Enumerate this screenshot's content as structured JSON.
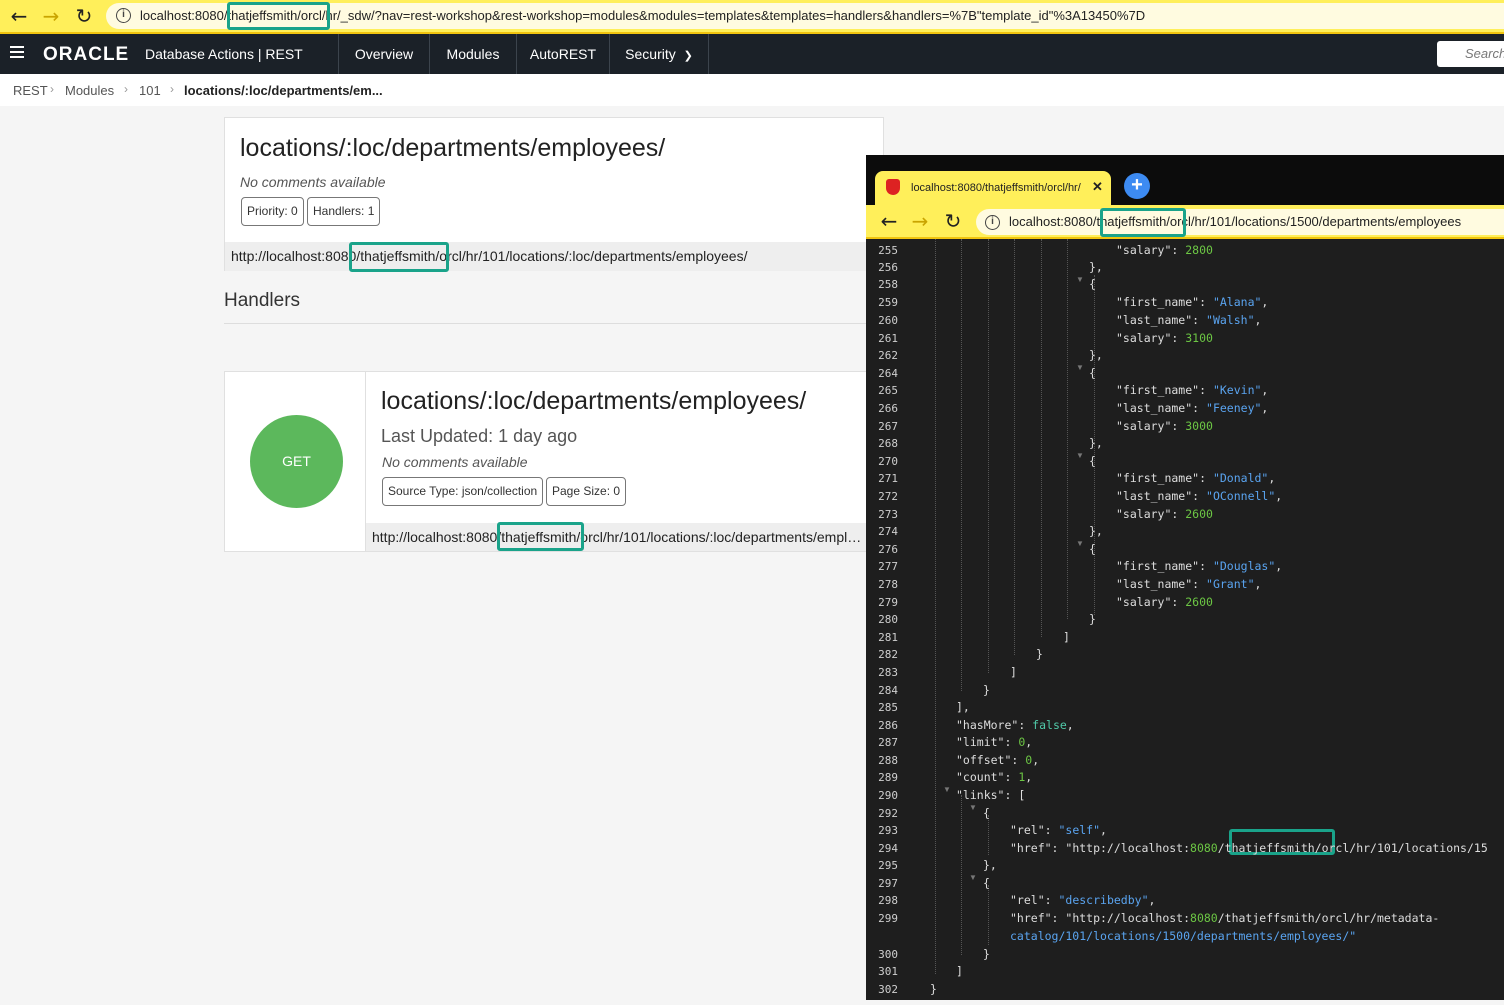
{
  "browser": {
    "url": "localhost:8080/thatjeffsmith/orcl/hr/_sdw/?nav=rest-workshop&rest-workshop=modules&modules=templates&templates=handlers&handlers=%7B\"template_id\"%3A13450%7D"
  },
  "app": {
    "logo": "ORACLE",
    "title": "Database Actions |  REST",
    "nav": [
      "Overview",
      "Modules",
      "AutoREST",
      "Security"
    ],
    "search_placeholder": "Search"
  },
  "breadcrumb": [
    "REST",
    "Modules",
    "101",
    "locations/:loc/departments/em..."
  ],
  "template_card": {
    "title": "locations/:loc/departments/employees/",
    "comment": "No comments available",
    "chips": [
      "Priority: 0",
      "Handlers: 1"
    ],
    "url": "http://localhost:8080/thatjeffsmith/orcl/hr/101/locations/:loc/departments/employees/"
  },
  "handlers_heading": "Handlers",
  "handler_card": {
    "method": "GET",
    "title": "locations/:loc/departments/employees/",
    "last_updated": "Last Updated: 1 day ago",
    "comment": "No comments available",
    "chips": [
      "Source Type: json/collection",
      "Page Size: 0"
    ],
    "url": "http://localhost:8080/thatjeffsmith/orcl/hr/101/locations/:loc/departments/empl…"
  },
  "second_window": {
    "tab_title": "localhost:8080/thatjeffsmith/orcl/hr/",
    "url": "localhost:8080/thatjeffsmith/orcl/hr/101/locations/1500/departments/employees",
    "json_lines": [
      {
        "n": "255",
        "text": "\"salary\": 2800"
      },
      {
        "n": "256",
        "text": "},"
      },
      {
        "n": "258",
        "text": "{"
      },
      {
        "n": "259",
        "text": "\"first_name\": \"Alana\","
      },
      {
        "n": "260",
        "text": "\"last_name\": \"Walsh\","
      },
      {
        "n": "261",
        "text": "\"salary\": 3100"
      },
      {
        "n": "262",
        "text": "},"
      },
      {
        "n": "264",
        "text": "{"
      },
      {
        "n": "265",
        "text": "\"first_name\": \"Kevin\","
      },
      {
        "n": "266",
        "text": "\"last_name\": \"Feeney\","
      },
      {
        "n": "267",
        "text": "\"salary\": 3000"
      },
      {
        "n": "268",
        "text": "},"
      },
      {
        "n": "270",
        "text": "{"
      },
      {
        "n": "271",
        "text": "\"first_name\": \"Donald\","
      },
      {
        "n": "272",
        "text": "\"last_name\": \"OConnell\","
      },
      {
        "n": "273",
        "text": "\"salary\": 2600"
      },
      {
        "n": "274",
        "text": "},"
      },
      {
        "n": "276",
        "text": "{"
      },
      {
        "n": "277",
        "text": "\"first_name\": \"Douglas\","
      },
      {
        "n": "278",
        "text": "\"last_name\": \"Grant\","
      },
      {
        "n": "279",
        "text": "\"salary\": 2600"
      },
      {
        "n": "280",
        "text": "}"
      },
      {
        "n": "281",
        "text": "]"
      },
      {
        "n": "282",
        "text": "}"
      },
      {
        "n": "283",
        "text": "]"
      },
      {
        "n": "284",
        "text": "}"
      },
      {
        "n": "285",
        "text": "],"
      },
      {
        "n": "286",
        "text": "\"hasMore\": false,"
      },
      {
        "n": "287",
        "text": "\"limit\": 0,"
      },
      {
        "n": "288",
        "text": "\"offset\": 0,"
      },
      {
        "n": "289",
        "text": "\"count\": 1,"
      },
      {
        "n": "290",
        "text": "\"links\": ["
      },
      {
        "n": "292",
        "text": "{"
      },
      {
        "n": "293",
        "text": "\"rel\": \"self\","
      },
      {
        "n": "294",
        "text": "\"href\": \"http://localhost:8080/thatjeffsmith/orcl/hr/101/locations/15"
      },
      {
        "n": "295",
        "text": "},"
      },
      {
        "n": "297",
        "text": "{"
      },
      {
        "n": "298",
        "text": "\"rel\": \"describedby\","
      },
      {
        "n": "299",
        "text": "\"href\": \"http://localhost:8080/thatjeffsmith/orcl/hr/metadata-"
      },
      {
        "n": "",
        "text": "catalog/101/locations/1500/departments/employees/\""
      },
      {
        "n": "300",
        "text": "}"
      },
      {
        "n": "301",
        "text": "]"
      },
      {
        "n": "302",
        "text": "}"
      }
    ]
  },
  "colors": {
    "highlight": "#1aa38a",
    "get_badge": "#5cb85c",
    "url_bar": "#ffef5a",
    "app_header": "#1b2128"
  }
}
